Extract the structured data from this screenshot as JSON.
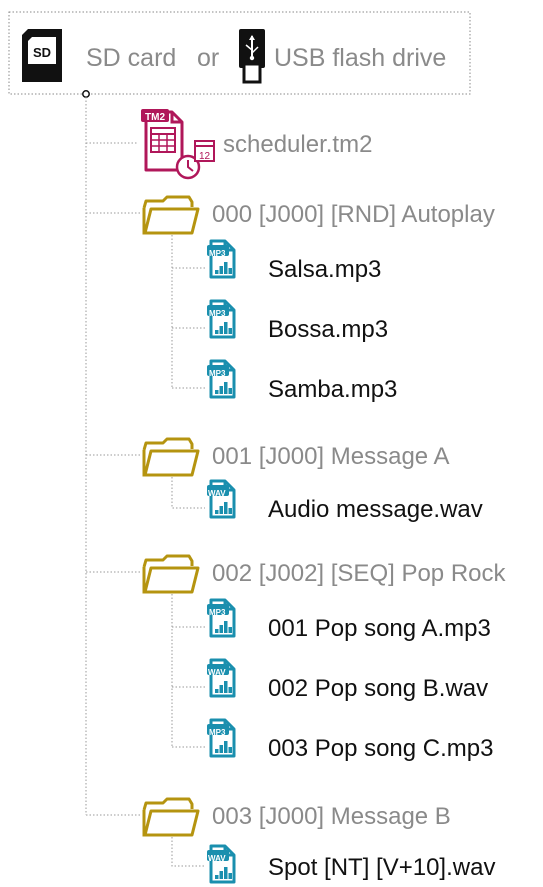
{
  "header": {
    "sd_label": "SD card",
    "or_label": "or",
    "usb_label": "USB flash drive",
    "sd_icon_text": "SD"
  },
  "scheduler": {
    "name": "scheduler.tm2",
    "badge": "TM2",
    "calendar_num": "12"
  },
  "folders": [
    {
      "name": "000 [J000] [RND] Autoplay",
      "files": [
        {
          "type": "MP3",
          "name": "Salsa.mp3"
        },
        {
          "type": "MP3",
          "name": "Bossa.mp3"
        },
        {
          "type": "MP3",
          "name": "Samba.mp3"
        }
      ]
    },
    {
      "name": "001 [J000] Message A",
      "files": [
        {
          "type": "WAV",
          "name": "Audio message.wav"
        }
      ]
    },
    {
      "name": "002 [J002] [SEQ] Pop Rock",
      "files": [
        {
          "type": "MP3",
          "name": "001 Pop song A.mp3"
        },
        {
          "type": "WAV",
          "name": "002 Pop song B.wav"
        },
        {
          "type": "MP3",
          "name": "003 Pop song C.mp3"
        }
      ]
    },
    {
      "name": "003 [J000] Message B",
      "files": [
        {
          "type": "WAV",
          "name": "Spot [NT] [V+10].wav"
        }
      ]
    }
  ],
  "colors": {
    "folder": "#b59410",
    "audio_icon": "#1a8fae",
    "scheduler_icon": "#b0175a",
    "label_gray": "#8a8a8a",
    "label_black": "#111111"
  }
}
